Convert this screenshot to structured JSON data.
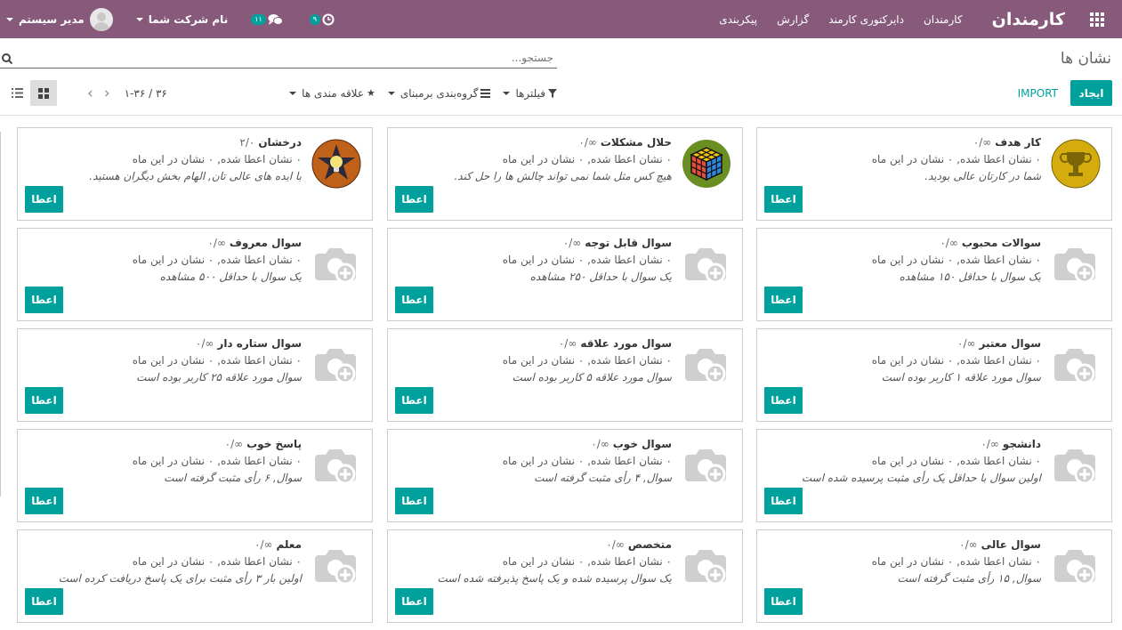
{
  "navbar": {
    "brand": "کارمندان",
    "menu": [
      "کارمندان",
      "دایرکتوری کارمند",
      "گزارش",
      "پیکربندی"
    ],
    "user_name": "مدیر سیستم",
    "company_name": "نام شرکت شما",
    "messages_badge": "۱۱",
    "activities_badge": "۹"
  },
  "header": {
    "title": "نشان ها",
    "search_placeholder": "جستجو...",
    "create_label": "ایجاد",
    "import_label": "IMPORT",
    "filters_label": "فیلترها",
    "groupby_label": "گروه‌بندی برمبنای",
    "favorites_label": "علاقه مندی ها",
    "pager_value": "۱-۳۶ / ۳۶"
  },
  "colors": {
    "navbar": "#875a7b",
    "accent": "#00a09d"
  },
  "cards": [
    {
      "name": "کار هدف",
      "count": "∞/۰",
      "stats": "۰ نشان اعطا شده, ۰ نشان در این ماه",
      "desc": "شما در کارتان عالی بودید.",
      "icon": "trophy-icon",
      "button": "اعطا"
    },
    {
      "name": "حلال مشکلات",
      "count": "∞/۰",
      "stats": "۰ نشان اعطا شده, ۰ نشان در این ماه",
      "desc": "هیچ کس مثل شما نمی تواند چالش ها را حل کند.",
      "icon": "rubiks-cube-icon",
      "button": "اعطا"
    },
    {
      "name": "درخشان",
      "count": "۲/۰",
      "stats": "۰ نشان اعطا شده, ۰ نشان در این ماه",
      "desc": "با ایده های عالی تان, الهام بخش دیگران هستید.",
      "icon": "star-lightbulb-icon",
      "button": "اعطا"
    },
    {
      "name": "سوالات محبوب",
      "count": "∞/۰",
      "stats": "۰ نشان اعطا شده, ۰ نشان در این ماه",
      "desc": "یک سوال با حداقل ۱۵۰ مشاهده",
      "icon": "camera-add-icon",
      "button": "اعطا"
    },
    {
      "name": "سوال قابل توجه",
      "count": "∞/۰",
      "stats": "۰ نشان اعطا شده, ۰ نشان در این ماه",
      "desc": "یک سوال با حداقل ۲۵۰ مشاهده",
      "icon": "camera-add-icon",
      "button": "اعطا"
    },
    {
      "name": "سوال معروف",
      "count": "∞/۰",
      "stats": "۰ نشان اعطا شده, ۰ نشان در این ماه",
      "desc": "یک سوال با حداقل ۵۰۰ مشاهده",
      "icon": "camera-add-icon",
      "button": "اعطا"
    },
    {
      "name": "سوال معتبر",
      "count": "∞/۰",
      "stats": "۰ نشان اعطا شده, ۰ نشان در این ماه",
      "desc": "سوال مورد علاقه ۱ کاربر بوده است",
      "icon": "camera-add-icon",
      "button": "اعطا"
    },
    {
      "name": "سوال مورد علاقه",
      "count": "∞/۰",
      "stats": "۰ نشان اعطا شده, ۰ نشان در این ماه",
      "desc": "سوال مورد علاقه ۵ کاربر بوده است",
      "icon": "camera-add-icon",
      "button": "اعطا"
    },
    {
      "name": "سوال ستاره دار",
      "count": "∞/۰",
      "stats": "۰ نشان اعطا شده, ۰ نشان در این ماه",
      "desc": "سوال مورد علاقه ۲۵ کاربر بوده است",
      "icon": "camera-add-icon",
      "button": "اعطا"
    },
    {
      "name": "دانشجو",
      "count": "∞/۰",
      "stats": "۰ نشان اعطا شده, ۰ نشان در این ماه",
      "desc": "اولین سوال با حداقل یک رأی مثبت پرسیده شده است",
      "icon": "camera-add-icon",
      "button": "اعطا"
    },
    {
      "name": "سوال خوب",
      "count": "∞/۰",
      "stats": "۰ نشان اعطا شده, ۰ نشان در این ماه",
      "desc": "سوال, ۴ رأی مثبت گرفته است",
      "icon": "camera-add-icon",
      "button": "اعطا"
    },
    {
      "name": "پاسخ خوب",
      "count": "∞/۰",
      "stats": "۰ نشان اعطا شده, ۰ نشان در این ماه",
      "desc": "سوال, ۶ رأی مثبت گرفته است",
      "icon": "camera-add-icon",
      "button": "اعطا"
    },
    {
      "name": "سوال عالی",
      "count": "∞/۰",
      "stats": "۰ نشان اعطا شده, ۰ نشان در این ماه",
      "desc": "سوال, ۱۵ رأی مثبت گرفته است",
      "icon": "camera-add-icon",
      "button": "اعطا"
    },
    {
      "name": "متخصص",
      "count": "∞/۰",
      "stats": "۰ نشان اعطا شده, ۰ نشان در این ماه",
      "desc": "یک سوال پرسیده شده و یک پاسخ پذیرفته شده است",
      "icon": "camera-add-icon",
      "button": "اعطا"
    },
    {
      "name": "معلم",
      "count": "∞/۰",
      "stats": "۰ نشان اعطا شده, ۰ نشان در این ماه",
      "desc": "اولین بار ۳ رأی مثبت برای یک پاسخ دریافت کرده است",
      "icon": "camera-add-icon",
      "button": "اعطا"
    }
  ]
}
